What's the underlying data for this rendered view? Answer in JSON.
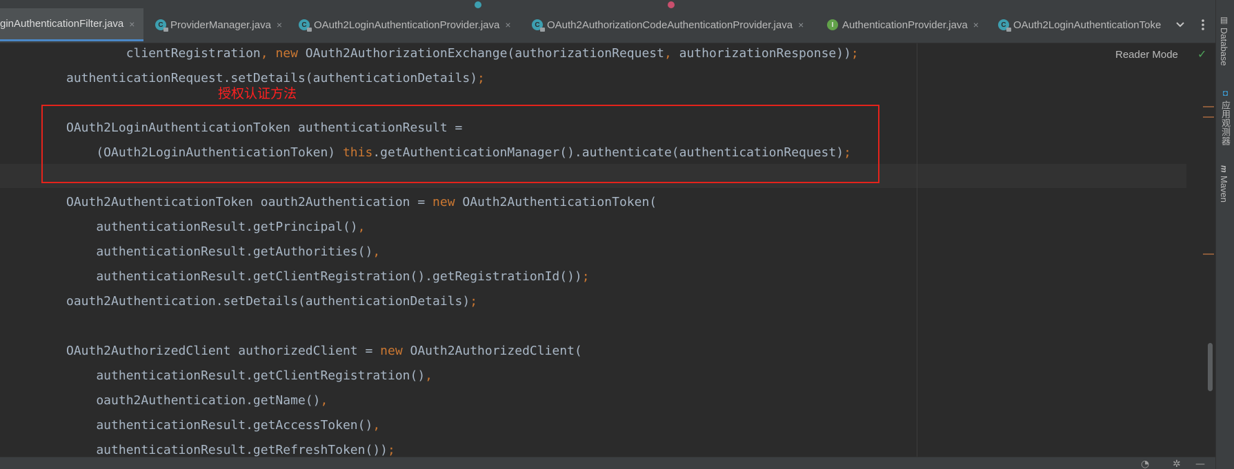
{
  "tabs": [
    {
      "label": "ginAuthenticationFilter.java",
      "kind": "class",
      "active": true
    },
    {
      "label": "ProviderManager.java",
      "kind": "class",
      "active": false
    },
    {
      "label": "OAuth2LoginAuthenticationProvider.java",
      "kind": "class",
      "active": false
    },
    {
      "label": "OAuth2AuthorizationCodeAuthenticationProvider.java",
      "kind": "class",
      "active": false
    },
    {
      "label": "AuthenticationProvider.java",
      "kind": "interface",
      "active": false
    },
    {
      "label": "OAuth2LoginAuthenticationToke",
      "kind": "class",
      "active": false
    }
  ],
  "tab_icons": {
    "class": "C",
    "interface": "I",
    "close": "×"
  },
  "tab_menu": {
    "overflow_icon": "chevron-down-icon",
    "more_icon": "more-vertical-icon"
  },
  "editor": {
    "reader_mode": "Reader Mode",
    "annotation": "授权认证方法",
    "code_lines": [
      "        clientRegistration, new OAuth2AuthorizationExchange(authorizationRequest, authorizationResponse));",
      "authenticationRequest.setDetails(authenticationDetails);",
      "",
      "OAuth2LoginAuthenticationToken authenticationResult =",
      "    (OAuth2LoginAuthenticationToken) this.getAuthenticationManager().authenticate(authenticationRequest);",
      "",
      "OAuth2AuthenticationToken oauth2Authentication = new OAuth2AuthenticationToken(",
      "    authenticationResult.getPrincipal(),",
      "    authenticationResult.getAuthorities(),",
      "    authenticationResult.getClientRegistration().getRegistrationId());",
      "oauth2Authentication.setDetails(authenticationDetails);",
      "",
      "OAuth2AuthorizedClient authorizedClient = new OAuth2AuthorizedClient(",
      "    authenticationResult.getClientRegistration(),",
      "    oauth2Authentication.getName(),",
      "    authenticationResult.getAccessToken(),",
      "    authenticationResult.getRefreshToken());"
    ]
  },
  "tool_windows": [
    {
      "label": "Database",
      "icon": "database-icon"
    },
    {
      "label": "应用观测器",
      "icon": "observer-icon"
    },
    {
      "label": "Maven",
      "icon": "maven-icon"
    }
  ],
  "colors": {
    "background": "#2b2b2b",
    "text": "#a9b7c6",
    "keyword": "#cc7832",
    "annotation": "#ff2020",
    "highlight_box": "#e5231b",
    "accent": "#4a88c7"
  }
}
